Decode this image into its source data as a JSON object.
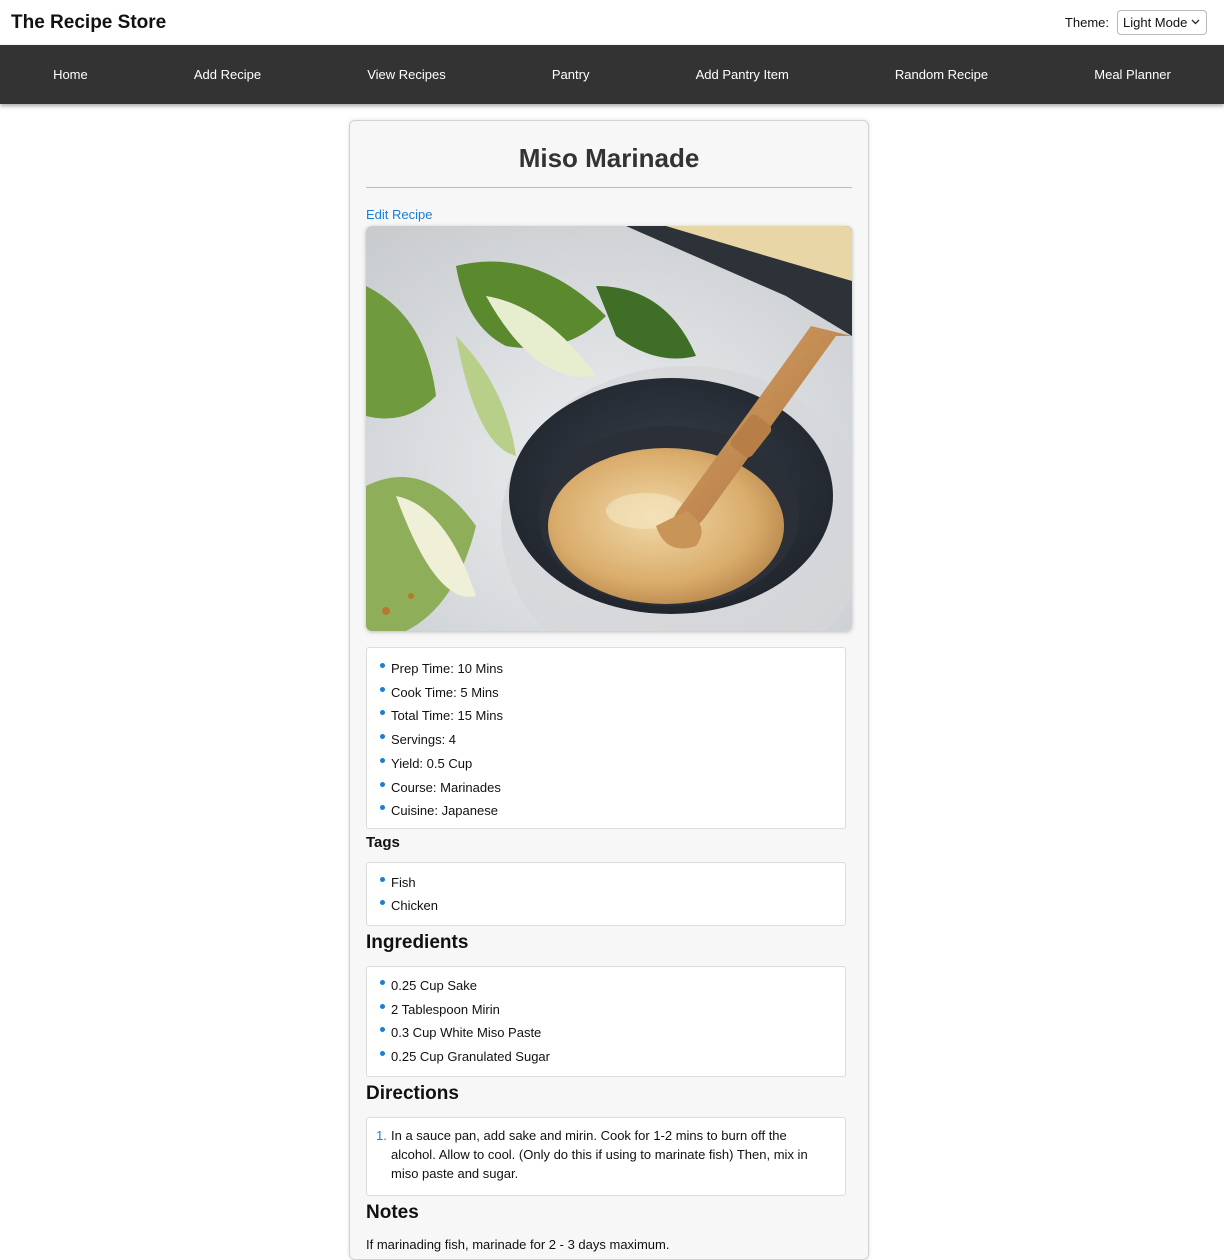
{
  "header": {
    "site_title": "The Recipe Store",
    "theme_label": "Theme:",
    "theme_value": "Light Mode"
  },
  "nav": {
    "items": [
      {
        "label": "Home"
      },
      {
        "label": "Add Recipe"
      },
      {
        "label": "View Recipes"
      },
      {
        "label": "Pantry"
      },
      {
        "label": "Add Pantry Item"
      },
      {
        "label": "Random Recipe"
      },
      {
        "label": "Meal Planner"
      }
    ]
  },
  "recipe": {
    "title": "Miso Marinade",
    "edit_label": "Edit Recipe",
    "details": [
      "Prep Time: 10 Mins",
      "Cook Time: 5 Mins",
      "Total Time: 15 Mins",
      "Servings: 4",
      "Yield: 0.5 Cup",
      "Course: Marinades",
      "Cuisine: Japanese"
    ],
    "tags_heading": "Tags",
    "tags": [
      "Fish",
      "Chicken"
    ],
    "ingredients_heading": "Ingredients",
    "ingredients": [
      "0.25 Cup Sake",
      "2 Tablespoon Mirin",
      "0.3 Cup White Miso Paste",
      "0.25 Cup Granulated Sugar"
    ],
    "directions_heading": "Directions",
    "directions": [
      "In a sauce pan, add sake and mirin. Cook for 1-2 mins to burn off the alcohol. Allow to cool. (Only do this if using to marinate fish) Then, mix in miso paste and sugar."
    ],
    "notes_heading": "Notes",
    "notes": "If marinading fish, marinade for 2 - 3 days maximum."
  },
  "colors": {
    "navbar": "#333333",
    "accent": "#1a7fd4",
    "card_bg": "#f7f7f7"
  },
  "icons": {
    "theme_dropdown": "chevron-down-icon"
  }
}
